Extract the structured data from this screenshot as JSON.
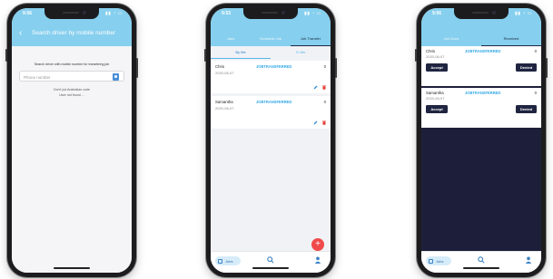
{
  "colors": {
    "header": "#86cfee",
    "accent": "#32a8e8",
    "fab": "#f04a4a",
    "dark_button": "#1f2540"
  },
  "phone1": {
    "status_time": "9:56",
    "header_title": "Search driver by mobile number",
    "back_icon": "back-arrow-icon",
    "hint": "Search driver with mobile number for transfering job",
    "phone_placeholder": "Phone number",
    "contact_icon": "contact-book-icon",
    "no_aus_code": "Don't put Australian code",
    "user_not_found": "User not found ..."
  },
  "phone2": {
    "status_time": "9:53",
    "tabs": [
      "Jobs",
      "Schedule Job",
      "Job Transfer"
    ],
    "subtabs": [
      "By Me",
      "To Me"
    ],
    "items": [
      {
        "name": "Chris",
        "date": "2020-06-07",
        "status": "JOBTRANSFERRED",
        "count": "0"
      },
      {
        "name": "Samantha",
        "date": "2020-06-07",
        "status": "JOBTRANSFERRED",
        "count": "0"
      }
    ],
    "fab_label": "+",
    "nav_jobs": "Jobs"
  },
  "phone3": {
    "status_time": "9:56",
    "tabs": [
      "Job Done",
      "Received"
    ],
    "items": [
      {
        "name": "Chris",
        "date": "2020-06-07",
        "status": "JOBTRANSFERRED",
        "count": "0",
        "accept": "Accept",
        "denied": "Denied"
      },
      {
        "name": "Samantha",
        "date": "2020-06-07",
        "status": "JOBTRANSFERRED",
        "count": "0",
        "accept": "Accept",
        "denied": "Denied"
      }
    ],
    "nav_jobs": "Jobs"
  }
}
